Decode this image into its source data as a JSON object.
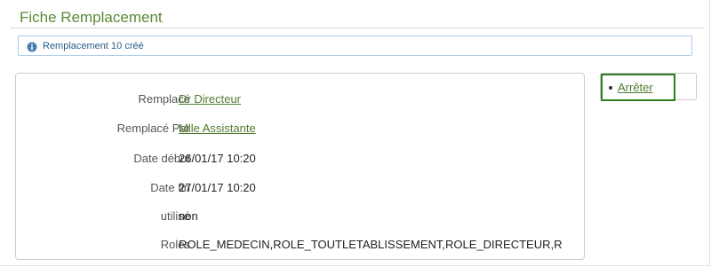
{
  "page": {
    "title": "Fiche Remplacement"
  },
  "notice": {
    "icon": "info-icon",
    "message": "Remplacement 10 créé",
    "color": "#2a5c8a"
  },
  "details": {
    "fields": [
      {
        "label": "Remplacé",
        "value": "Dr Directeur",
        "is_link": true
      },
      {
        "label": "Remplacé Par",
        "value": "Mlle Assistante",
        "is_link": true
      },
      {
        "label": "Date début",
        "value": "26/01/17 10:20",
        "is_link": false
      },
      {
        "label": "Date fin",
        "value": "27/01/17 10:20",
        "is_link": false
      },
      {
        "label": "utilisé",
        "value": "non",
        "is_link": false
      },
      {
        "label": "Roles",
        "value": "ROLE_MEDECIN,ROLE_TOUTLETABLISSEMENT,ROLE_DIRECTEUR,R",
        "is_link": false
      }
    ]
  },
  "actions": {
    "items": [
      {
        "label": "Arrêter"
      }
    ]
  },
  "colors": {
    "title": "#5a8a36",
    "link": "#4e7a2e",
    "action_border": "#2e7d1e"
  }
}
